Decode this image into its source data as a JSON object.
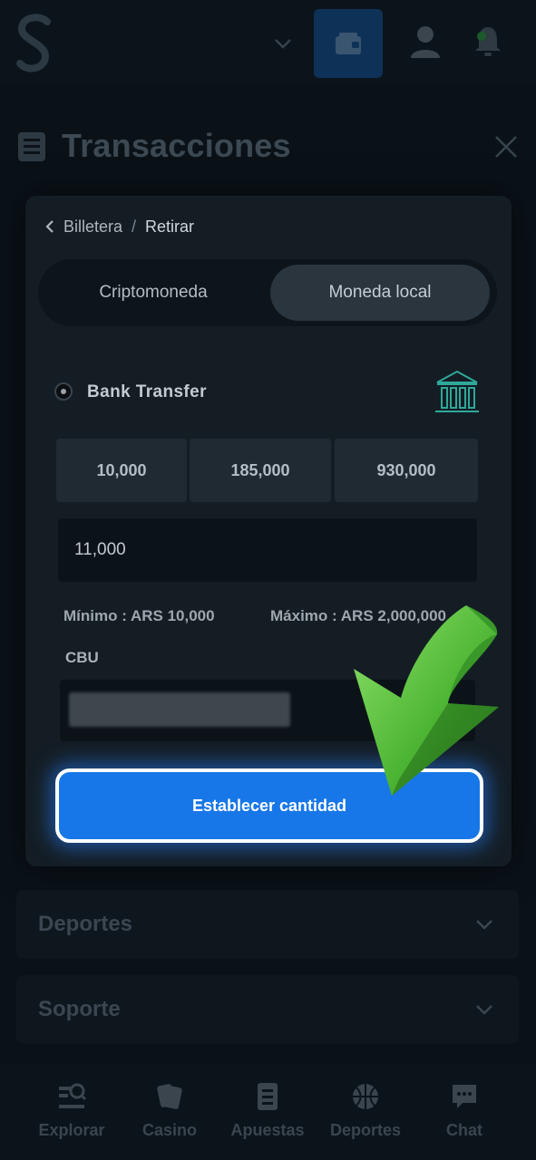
{
  "header": {
    "wallet_icon": "wallet-icon",
    "user_icon": "user-icon",
    "bell_icon": "bell-icon"
  },
  "page_title": "Transacciones",
  "breadcrumb": {
    "parent": "Billetera",
    "separator": "/",
    "current": "Retirar"
  },
  "tabs": [
    {
      "label": "Criptomoneda",
      "active": false
    },
    {
      "label": "Moneda local",
      "active": true
    }
  ],
  "method": {
    "label": "Bank Transfer",
    "icon": "bank-icon"
  },
  "amount_options": [
    "10,000",
    "185,000",
    "930,000"
  ],
  "amount_input": {
    "value": "11,000"
  },
  "limits": {
    "min": "Mínimo : ARS 10,000",
    "max": "Máximo : ARS 2,000,000"
  },
  "cbu": {
    "label": "CBU"
  },
  "submit_label": "Establecer cantidad",
  "accordions": [
    {
      "label": "Deportes"
    },
    {
      "label": "Soporte"
    }
  ],
  "bottom_nav": [
    {
      "label": "Explorar",
      "icon": "explore-icon"
    },
    {
      "label": "Casino",
      "icon": "cards-icon"
    },
    {
      "label": "Apuestas",
      "icon": "betslip-icon"
    },
    {
      "label": "Deportes",
      "icon": "basketball-icon"
    },
    {
      "label": "Chat",
      "icon": "chat-icon"
    }
  ],
  "colors": {
    "accent": "#1877e8",
    "arrow": "#4caf3a",
    "background": "#0a1218"
  }
}
